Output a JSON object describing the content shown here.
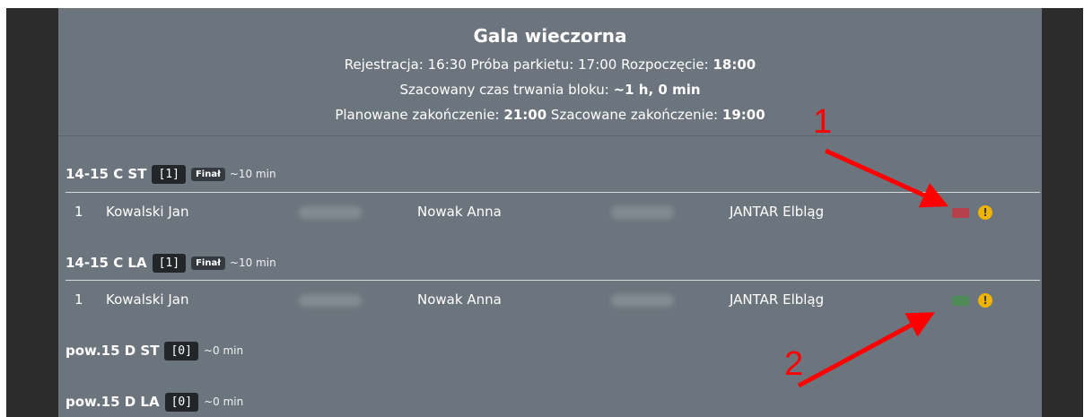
{
  "header": {
    "title": "Gala wieczorna",
    "registration_label": "Rejestracja:",
    "registration_time": "16:30",
    "rehearsal_label": "Próba parkietu:",
    "rehearsal_time": "17:00",
    "start_label": "Rozpoczęcie:",
    "start_time": "18:00",
    "duration_label": "Szacowany czas trwania bloku:",
    "duration_value": "~1 h, 0 min",
    "planned_end_label": "Planowane zakończenie:",
    "planned_end_time": "21:00",
    "estimated_end_label": "Szacowane zakończenie:",
    "estimated_end_time": "19:00"
  },
  "categories": [
    {
      "name": "14-15 C ST",
      "count": "[1]",
      "badge": "Finał",
      "duration": "~10 min",
      "rows": [
        {
          "no": "1",
          "partner": "Kowalski Jan",
          "partner2": "Nowak Anna",
          "club": "JANTAR Elbląg",
          "status_color": "#b5414c",
          "warning_icon": "exclamation-circle"
        }
      ]
    },
    {
      "name": "14-15 C LA",
      "count": "[1]",
      "badge": "Finał",
      "duration": "~10 min",
      "rows": [
        {
          "no": "1",
          "partner": "Kowalski Jan",
          "partner2": "Nowak Anna",
          "club": "JANTAR Elbląg",
          "status_color": "#4d8a55",
          "warning_icon": "exclamation-circle"
        }
      ]
    },
    {
      "name": "pow.15 D ST",
      "count": "[0]",
      "duration": "~0 min"
    },
    {
      "name": "pow.15 D LA",
      "count": "[0]",
      "duration": "~0 min"
    }
  ],
  "annotations": {
    "arrow_color": "#ff0000",
    "label1": "1",
    "label2": "2"
  }
}
